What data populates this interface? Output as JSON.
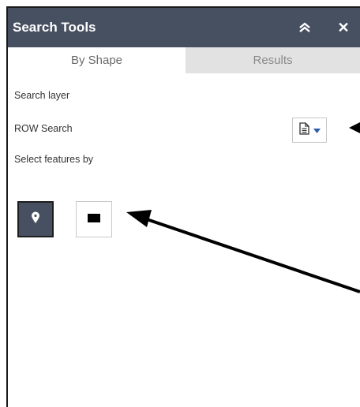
{
  "window": {
    "title": "Search Tools",
    "collapse_icon": "double-chevron-up-icon",
    "close_icon": "close-icon"
  },
  "tabs": [
    {
      "label": "By Shape",
      "active": true
    },
    {
      "label": "Results",
      "active": false
    }
  ],
  "search_layer": {
    "label": "Search layer",
    "value": "ROW Search",
    "dropdown_icon": "document-icon"
  },
  "select_features": {
    "label": "Select features by",
    "tools": [
      {
        "name": "point",
        "icon": "point-marker-icon",
        "selected": true
      },
      {
        "name": "rectangle",
        "icon": "rectangle-icon",
        "selected": false
      }
    ]
  },
  "colors": {
    "header_bg": "#475061",
    "tab_inactive_bg": "#e2e2e2",
    "selected_tool_bg": "#475061",
    "annotation": "#000000"
  }
}
